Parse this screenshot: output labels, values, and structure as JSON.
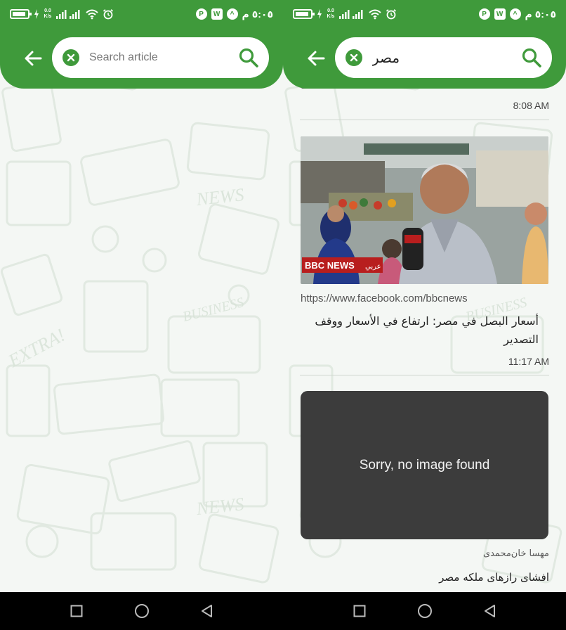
{
  "status_bar": {
    "net_speed_left": "0.0 K/s",
    "net_speed_right": "0.0 K/s",
    "time": "٥:٠٥ م",
    "battery_icon": "battery-icon",
    "signal_icon": "signal-icon",
    "wifi_icon": "wifi-icon",
    "alarm_icon": "alarm-icon",
    "notification_icons": [
      "p-app-icon",
      "word-app-icon",
      "hotspot-icon"
    ]
  },
  "colors": {
    "primary_green": "#3f9a3b",
    "wallpaper_bg": "#f4f7f4",
    "card_dark": "#3c3c3c"
  },
  "left_screen": {
    "search": {
      "placeholder": "Search article",
      "value": "",
      "clear_icon": "close-circle-icon",
      "search_icon": "search-icon",
      "back_icon": "arrow-left-icon"
    }
  },
  "right_screen": {
    "search": {
      "placeholder": "Search article",
      "value": "مصر",
      "clear_icon": "close-circle-icon",
      "search_icon": "search-icon",
      "back_icon": "arrow-left-icon"
    },
    "results": [
      {
        "time": "8:08 AM"
      },
      {
        "image_caption_brand": "BBC NEWS",
        "image_caption_lang": "عربي",
        "url": "https://www.facebook.com/bbcnews",
        "title": "أسعار البصل في مصر: ارتفاع في الأسعار ووقف التصدير",
        "time": "11:17 AM"
      },
      {
        "no_image_text": "Sorry, no image found",
        "source": "مهسا خان‌محمدی",
        "title": "افشای رازهای ملکه مصر"
      }
    ]
  },
  "nav_bar": {
    "icons": [
      "recent-apps-icon",
      "home-icon",
      "back-triangle-icon"
    ]
  }
}
